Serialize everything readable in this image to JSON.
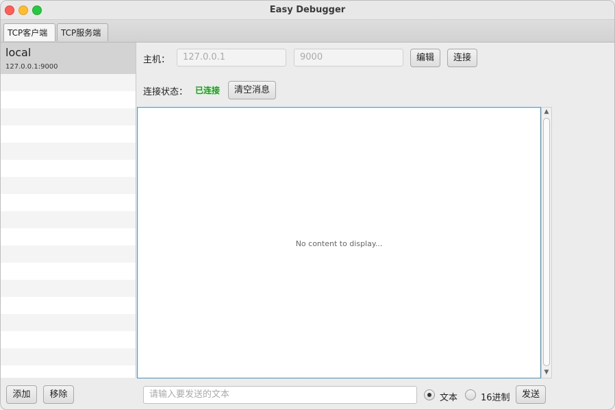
{
  "window": {
    "title": "Easy Debugger"
  },
  "tabs": [
    {
      "label": "TCP客户端",
      "active": true
    },
    {
      "label": "TCP服务端",
      "active": false
    }
  ],
  "sidebar": {
    "selected": {
      "name": "local",
      "address": "127.0.0.1:9000"
    }
  },
  "connection": {
    "host_label": "主机：",
    "host_placeholder": "127.0.0.1",
    "port_placeholder": "9000",
    "edit_label": "编辑",
    "connect_label": "连接",
    "status_label": "连接状态：",
    "status_value": "已连接",
    "status_color": "#1a9a1a",
    "clear_label": "清空消息"
  },
  "messages": {
    "empty_text": "No content to display..."
  },
  "footer": {
    "add_label": "添加",
    "remove_label": "移除",
    "input_placeholder": "请输入要发送的文本",
    "mode_text_label": "文本",
    "mode_hex_label": "16进制",
    "selected_mode": "text",
    "send_label": "发送"
  }
}
